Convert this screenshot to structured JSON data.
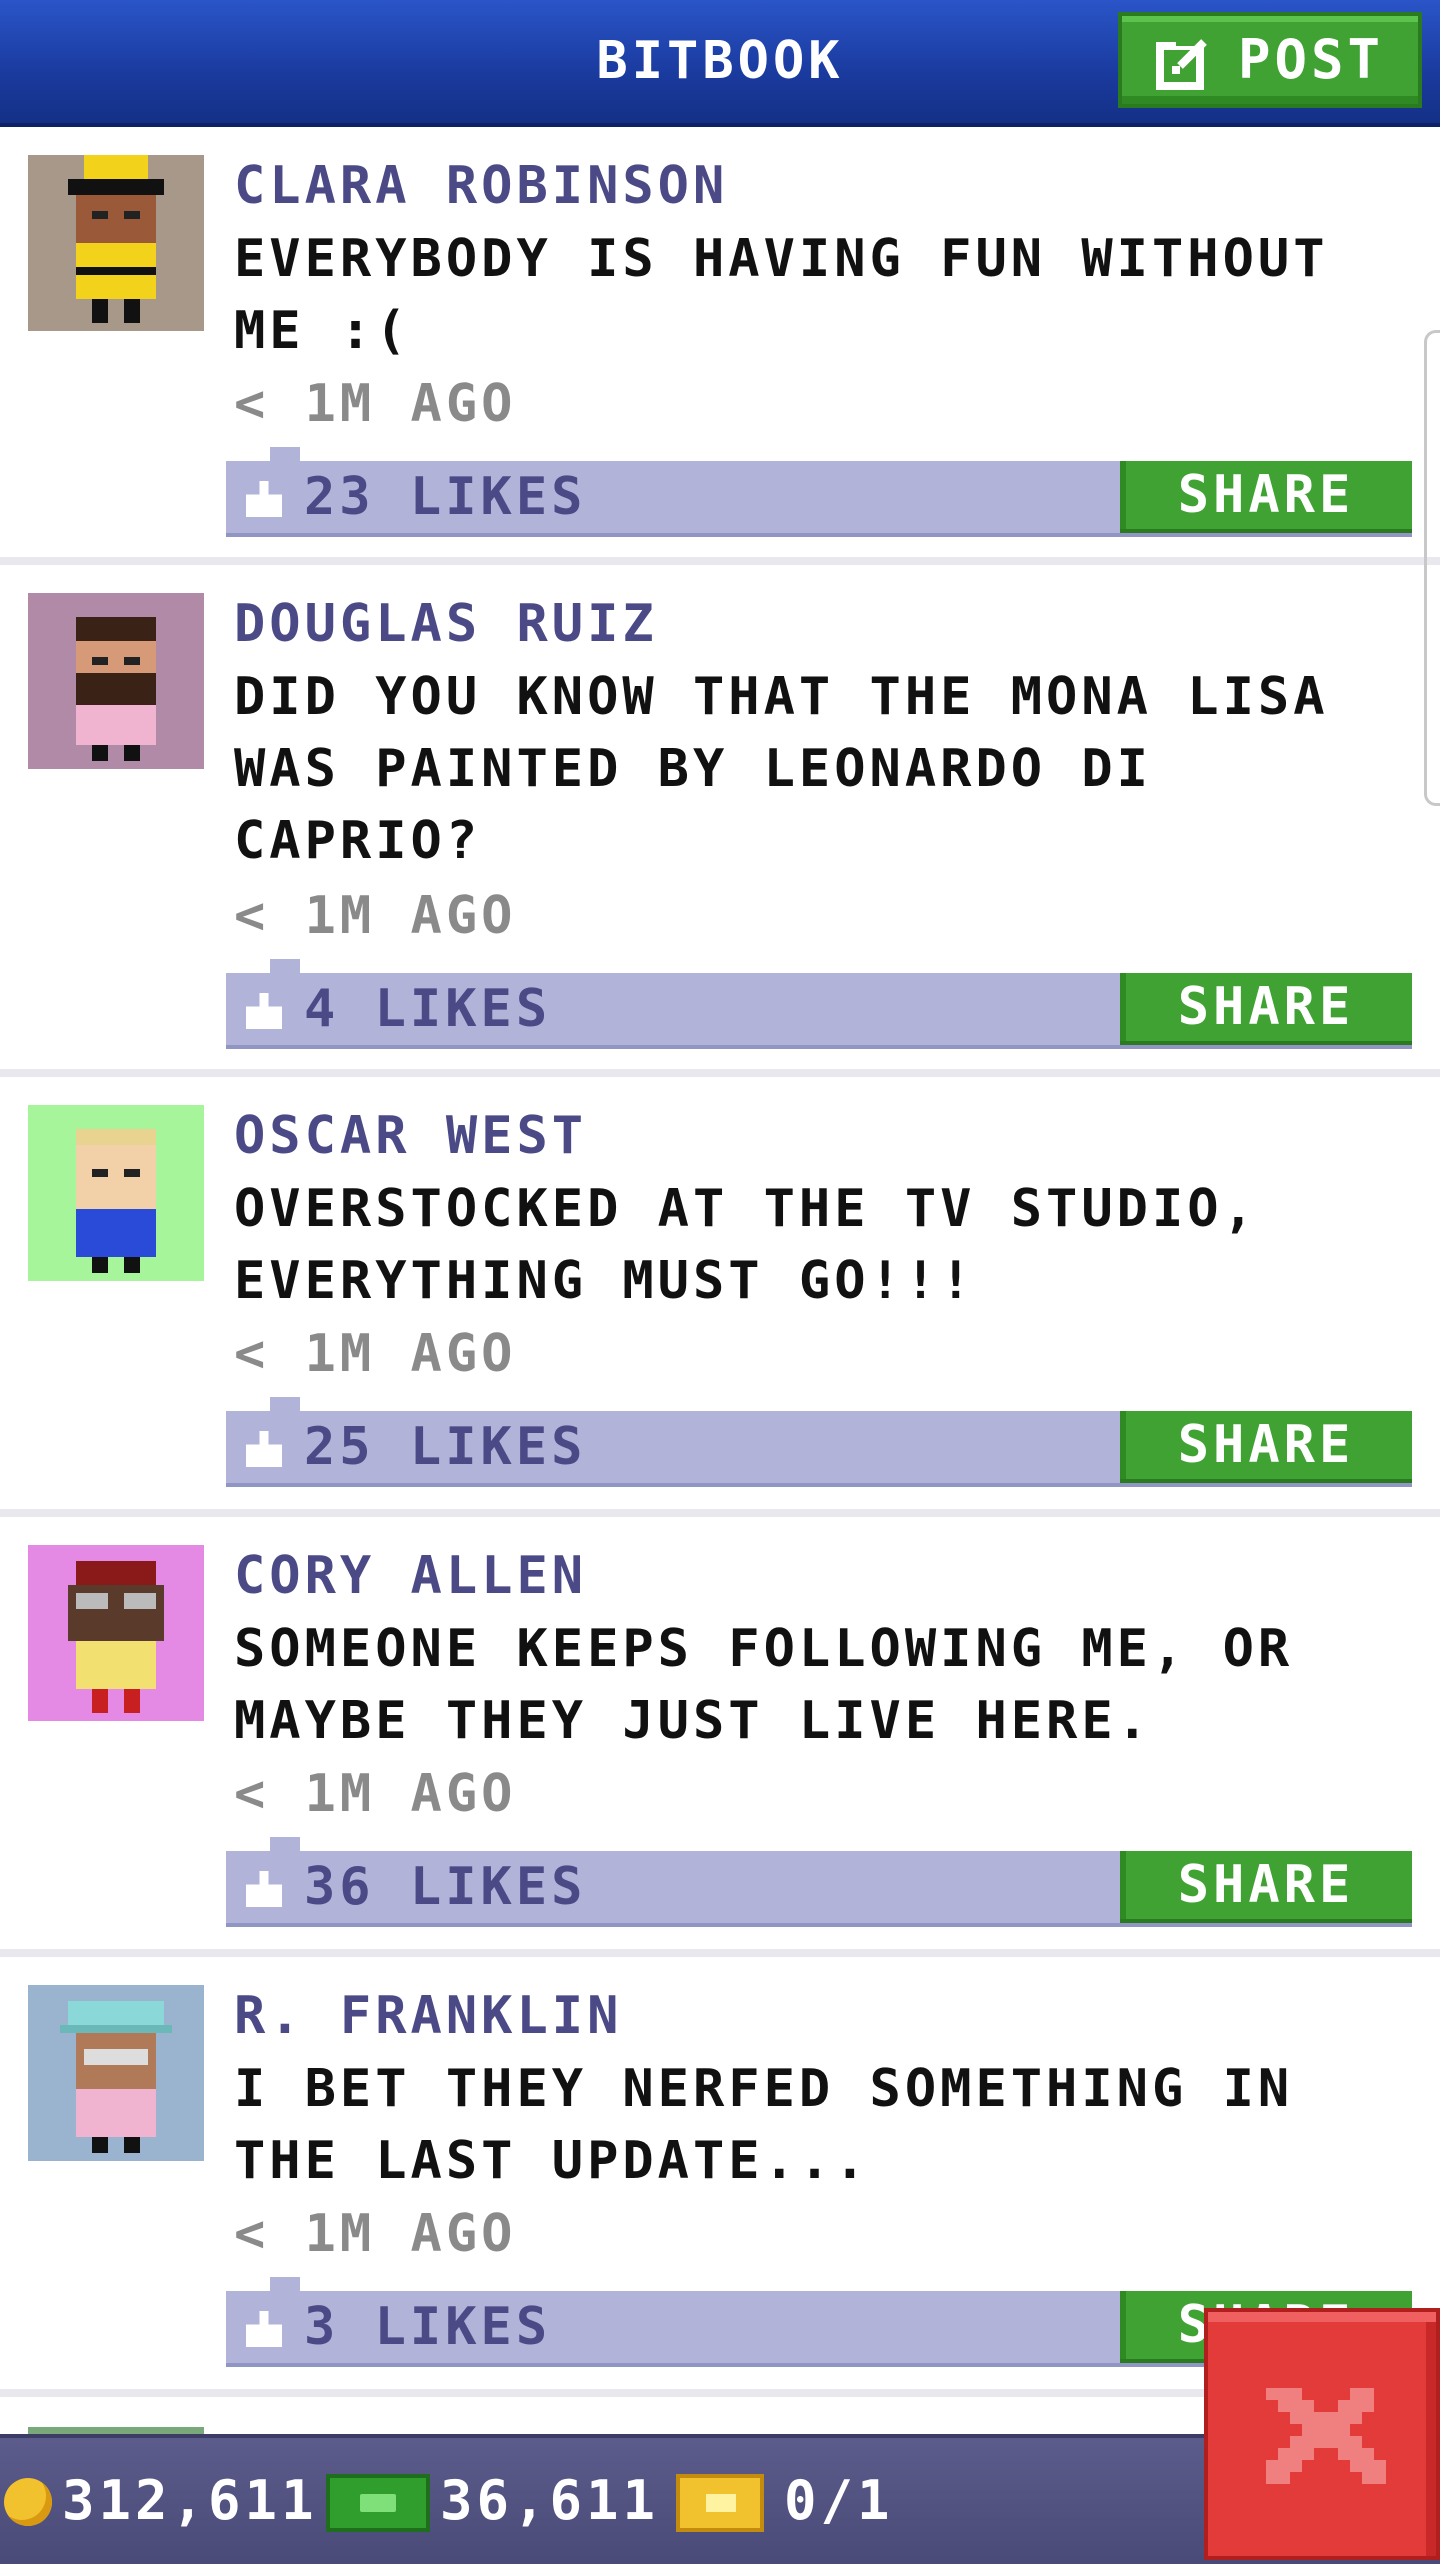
{
  "header": {
    "title": "BITBOOK",
    "post_label": "POST",
    "post_icon": "compose-icon"
  },
  "posts": [
    {
      "name": "CLARA ROBINSON",
      "message": "EVERYBODY IS HAVING FUN WITHOUT ME :(",
      "time": "< 1M AGO",
      "likes": "23 LIKES",
      "share": "SHARE",
      "avatar_bg": "#a8988a"
    },
    {
      "name": "DOUGLAS RUIZ",
      "message": "DID YOU KNOW THAT THE MONA LISA WAS PAINTED BY LEONARDO DI CAPRIO?",
      "time": "< 1M AGO",
      "likes": "4 LIKES",
      "share": "SHARE",
      "avatar_bg": "#b08aa6"
    },
    {
      "name": "OSCAR WEST",
      "message": "OVERSTOCKED AT THE TV STUDIO, EVERYTHING MUST GO!!!",
      "time": "< 1M AGO",
      "likes": "25 LIKES",
      "share": "SHARE",
      "avatar_bg": "#a6f59a"
    },
    {
      "name": "CORY ALLEN",
      "message": "SOMEONE KEEPS FOLLOWING ME, OR MAYBE THEY JUST LIVE HERE.",
      "time": "< 1M AGO",
      "likes": "36 LIKES",
      "share": "SHARE",
      "avatar_bg": "#e48ae4"
    },
    {
      "name": "R. FRANKLIN",
      "message": "I BET THEY NERFED SOMETHING IN THE LAST UPDATE...",
      "time": "< 1M AGO",
      "likes": "3 LIKES",
      "share": "SHARE",
      "avatar_bg": "#9ab4d0"
    }
  ],
  "bottom_bar": {
    "coins": "312,611",
    "bux": "36,611",
    "tickets": "0/1"
  },
  "colors": {
    "header_blue": "#1a3a9e",
    "share_green": "#3fa232",
    "likes_bar": "#b1b4d8",
    "name_purple": "#4b4a86",
    "close_red": "#e33a3a"
  }
}
